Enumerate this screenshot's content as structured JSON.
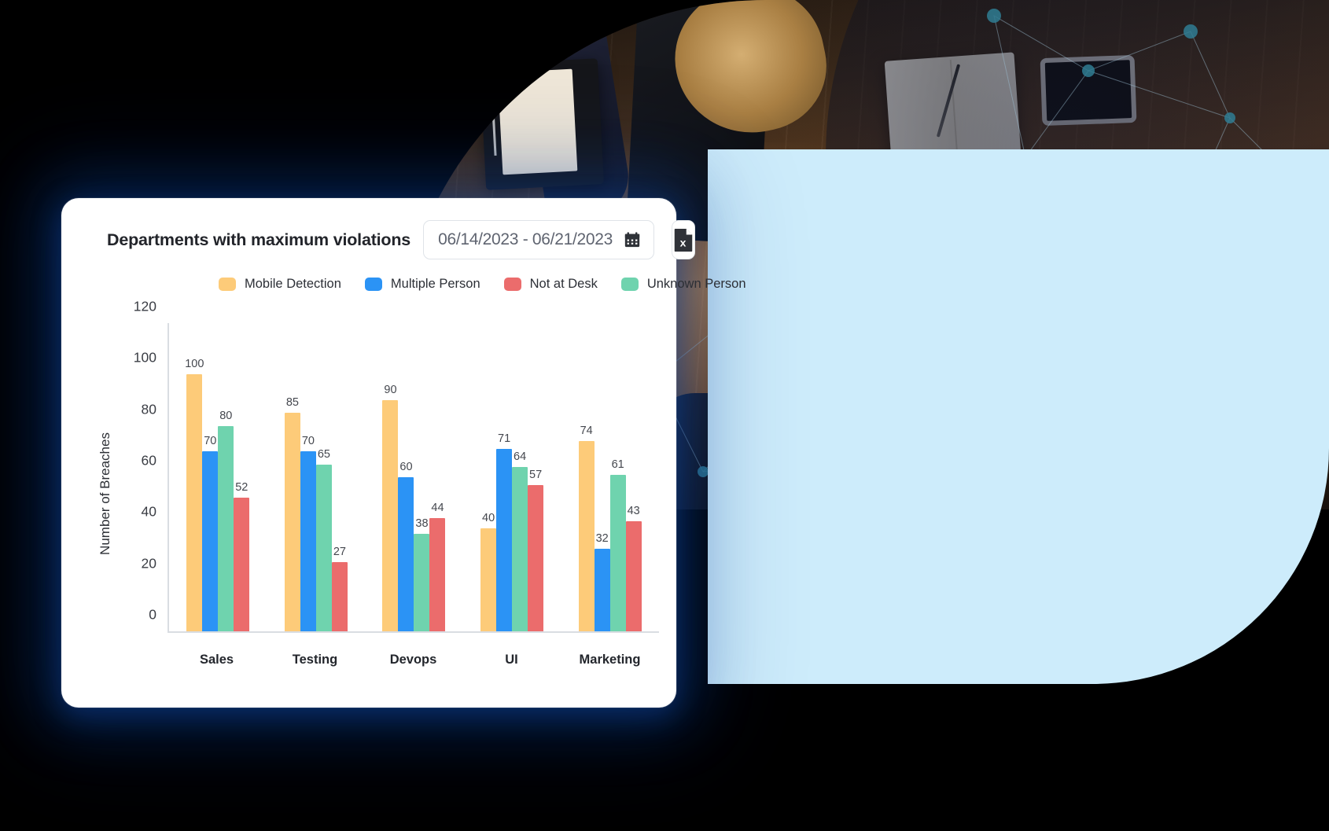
{
  "card": {
    "title": "Departments with maximum violations",
    "date_range": "06/14/2023 - 06/21/2023",
    "calendar_icon": "calendar-icon",
    "export_icon": "excel-export-icon"
  },
  "legend": [
    {
      "label": "Mobile Detection",
      "color": "#FDCB79"
    },
    {
      "label": "Multiple Person",
      "color": "#2B93F5"
    },
    {
      "label": "Not at Desk",
      "color": "#EB6C6C"
    },
    {
      "label": "Unknown Person",
      "color": "#6FD3AE"
    }
  ],
  "colors": {
    "mobile_detection": "#FDCB79",
    "multiple_person": "#2B93F5",
    "not_at_desk": "#EB6C6C",
    "unknown_person": "#6FD3AE",
    "blue_panel": "#CDECFB",
    "card_background": "#FFFFFF",
    "page_background": "#000000"
  },
  "chart_data": {
    "type": "bar",
    "title": "Departments with maximum violations",
    "xlabel": "",
    "ylabel": "Number of Breaches",
    "categories": [
      "Sales",
      "Testing",
      "Devops",
      "UI",
      "Marketing"
    ],
    "ylim": [
      0,
      120
    ],
    "yticks": [
      0,
      20,
      40,
      60,
      80,
      100,
      120
    ],
    "grid": false,
    "legend_position": "top-left",
    "bar_draw_order": [
      "Mobile Detection",
      "Multiple Person",
      "Unknown Person",
      "Not at Desk"
    ],
    "series": [
      {
        "name": "Mobile Detection",
        "color": "#FDCB79",
        "values": [
          100,
          85,
          90,
          40,
          74
        ]
      },
      {
        "name": "Multiple Person",
        "color": "#2B93F5",
        "values": [
          70,
          70,
          60,
          71,
          32
        ]
      },
      {
        "name": "Unknown Person",
        "color": "#6FD3AE",
        "values": [
          80,
          65,
          38,
          64,
          61
        ]
      },
      {
        "name": "Not at Desk",
        "color": "#EB6C6C",
        "values": [
          52,
          27,
          44,
          57,
          43
        ]
      }
    ]
  }
}
